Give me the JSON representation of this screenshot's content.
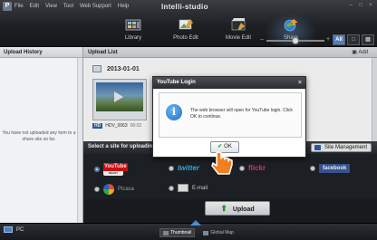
{
  "app": {
    "logo": "P",
    "title": "Intelli-studio",
    "menu": [
      "File",
      "Edit",
      "View",
      "Tool",
      "Web Support",
      "Help"
    ],
    "window_controls": [
      "–",
      "□",
      "×"
    ]
  },
  "tabs": [
    {
      "label": "Library",
      "icon": "library-icon"
    },
    {
      "label": "Photo Edit",
      "icon": "photo-edit-icon"
    },
    {
      "label": "Movie Edit",
      "icon": "movie-edit-icon"
    },
    {
      "label": "Share",
      "icon": "share-icon"
    }
  ],
  "zoom": {
    "minus": "–",
    "plus": "+",
    "level": 0.5
  },
  "view_buttons": [
    "All",
    "□",
    "▤"
  ],
  "left_panel": {
    "title": "Upload History",
    "empty_message": "You have not uploaded any item to a share site so far."
  },
  "main_panel": {
    "title": "Upload List",
    "add_label": "Add",
    "date": "2013-01-01",
    "thumbnail": {
      "badge": "HD",
      "filename": "HDV_0063",
      "duration": "00:02"
    },
    "select_site_label": "Select a site for uploading.",
    "site_management_label": "Site Management",
    "upload_label": "Upload",
    "sites": [
      {
        "name": "YouTube",
        "ready": "READY",
        "selected": true
      },
      {
        "name": "twitter",
        "selected": false
      },
      {
        "name": "flickr",
        "selected": false
      },
      {
        "name": "facebook",
        "selected": false
      },
      {
        "name": "Picasa",
        "selected": false
      },
      {
        "name": "E-mail",
        "selected": false
      }
    ]
  },
  "bottom": {
    "pc_label": "PC",
    "tabs": [
      "Thumbnail",
      "Global Map"
    ]
  },
  "dialog": {
    "title": "YouTube Login",
    "message": "The web browser will open for YouTube login. Click OK to continue.",
    "ok_label": "OK",
    "close": "×"
  },
  "colors": {
    "accent": "#4a7fc4",
    "youtube": "#dd1111",
    "facebook": "#3b5998",
    "twitter": "#35b6f0",
    "flickr": "#e4318d",
    "pointer": "#f08020"
  }
}
